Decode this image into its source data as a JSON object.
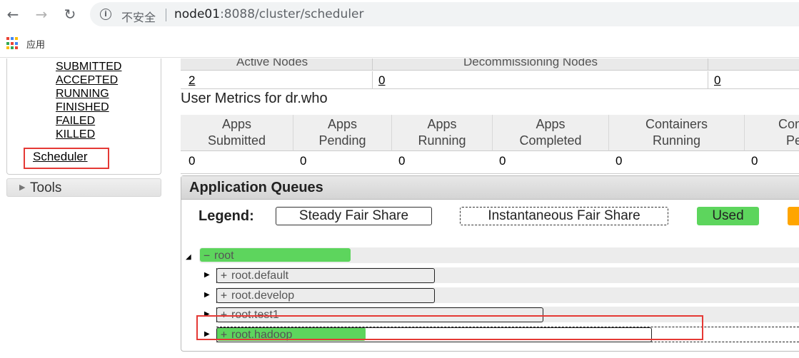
{
  "browser": {
    "back_icon": "arrow-left-icon",
    "forward_icon": "arrow-right-icon",
    "reload_icon": "reload-icon",
    "security_label": "不安全",
    "url_host": "node01",
    "url_path": ":8088/cluster/scheduler",
    "bookmarks_apps_label": "应用"
  },
  "sidebar": {
    "app_states": [
      "SUBMITTED",
      "ACCEPTED",
      "RUNNING",
      "FINISHED",
      "FAILED",
      "KILLED"
    ],
    "scheduler_label": "Scheduler",
    "tools_label": "Tools"
  },
  "cluster_metrics": {
    "headers": [
      "Active Nodes",
      "Decommissioning Nodes"
    ],
    "values": [
      "2",
      "0",
      "0"
    ]
  },
  "user_metrics": {
    "title": "User Metrics for dr.who",
    "headers": [
      {
        "line1": "Apps",
        "line2": "Submitted"
      },
      {
        "line1": "Apps",
        "line2": "Pending"
      },
      {
        "line1": "Apps",
        "line2": "Running"
      },
      {
        "line1": "Apps",
        "line2": "Completed"
      },
      {
        "line1": "Containers",
        "line2": "Running"
      },
      {
        "line1": "Con",
        "line2": "Pe"
      }
    ],
    "values": [
      "0",
      "0",
      "0",
      "0",
      "0",
      "0"
    ]
  },
  "application_queues": {
    "title": "Application Queues",
    "legend": {
      "label": "Legend:",
      "steady": "Steady Fair Share",
      "instantaneous": "Instantaneous Fair Share",
      "used": "Used"
    },
    "colors": {
      "used": "#5dd55d",
      "over_capacity": "#ffa500",
      "highlight": "#e53935"
    },
    "queues": [
      {
        "name": "root",
        "symbol": "−",
        "expanded": true
      },
      {
        "name": "root.default",
        "symbol": "+",
        "expanded": false
      },
      {
        "name": "root.develop",
        "symbol": "+",
        "expanded": false
      },
      {
        "name": "root.test1",
        "symbol": "+",
        "expanded": false
      },
      {
        "name": "root.hadoop",
        "symbol": "+",
        "expanded": false
      }
    ]
  }
}
